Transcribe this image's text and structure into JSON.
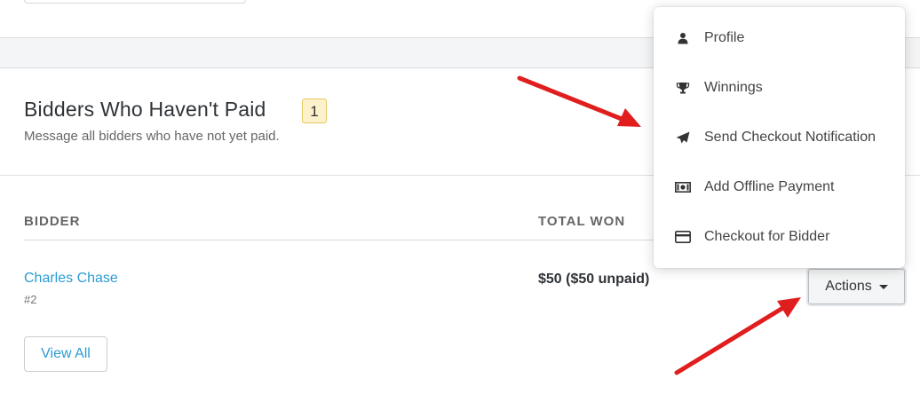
{
  "section": {
    "title": "Bidders Who Haven't Paid",
    "count": "1",
    "subtitle": "Message all bidders who have not yet paid."
  },
  "table": {
    "headers": {
      "bidder": "BIDDER",
      "total_won": "TOTAL WON"
    },
    "rows": [
      {
        "name": "Charles Chase",
        "number": "#2",
        "total": "$50 ($50 unpaid)",
        "action_label": "Actions"
      }
    ]
  },
  "view_all_label": "View All",
  "menu": {
    "items": [
      {
        "label": "Profile",
        "icon": "user-icon"
      },
      {
        "label": "Winnings",
        "icon": "trophy-icon"
      },
      {
        "label": "Send Checkout Notification",
        "icon": "paper-plane-icon"
      },
      {
        "label": "Add Offline Payment",
        "icon": "money-bill-icon"
      },
      {
        "label": "Checkout for Bidder",
        "icon": "credit-card-icon"
      }
    ]
  },
  "colors": {
    "link": "#2c9bd3",
    "badge_bg": "#fdf1cc",
    "badge_border": "#e6c85f",
    "annotation_arrow": "#e01e1e"
  }
}
